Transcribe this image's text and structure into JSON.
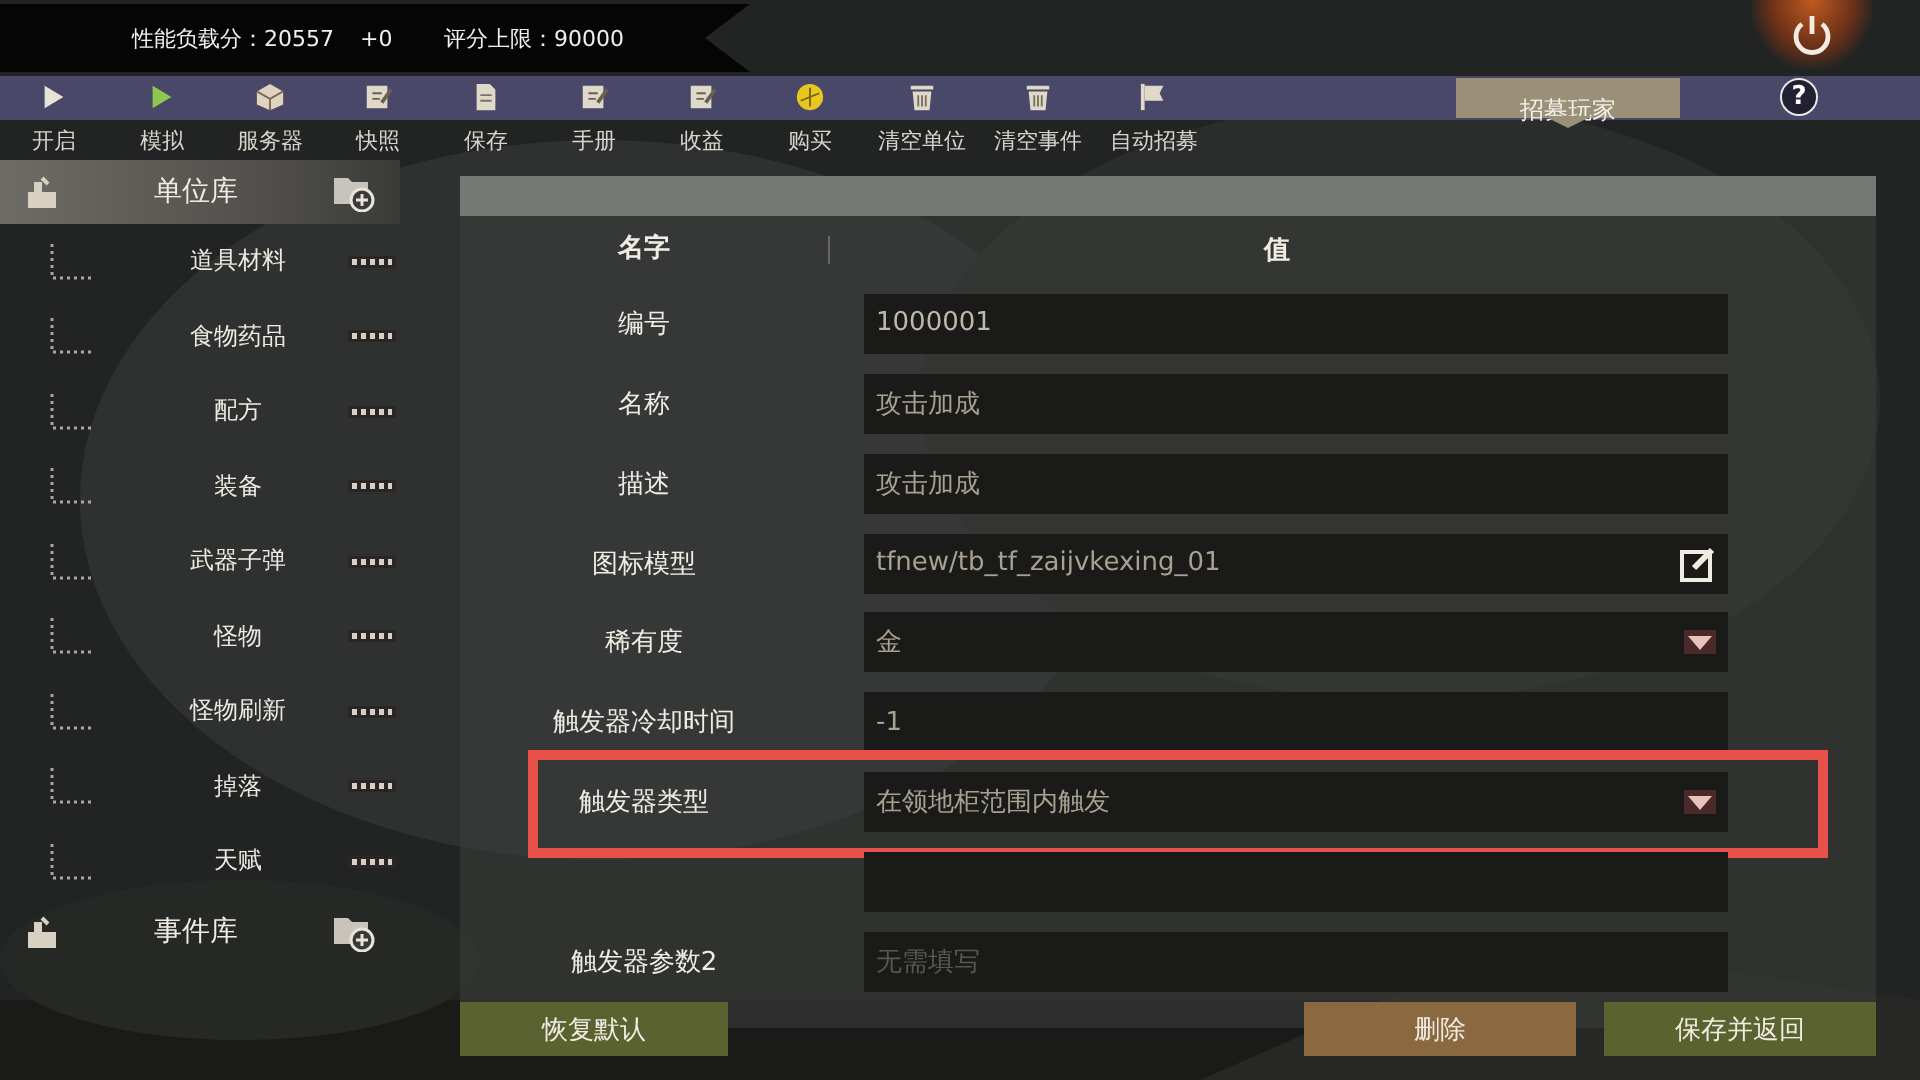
{
  "stats": [
    {
      "label": "性能负载分：20557"
    },
    {
      "label": "+0"
    },
    {
      "label": "评分上限：90000"
    }
  ],
  "toolbar": [
    {
      "label": "开启",
      "color": "#e8e4d8"
    },
    {
      "label": "模拟",
      "color": "#8cc850"
    },
    {
      "label": "服务器",
      "color": "#e0d4c0"
    },
    {
      "label": "快照",
      "color": "#e0d8c8"
    },
    {
      "label": "保存",
      "color": "#e0d8c8"
    },
    {
      "label": "手册",
      "color": "#e0d8c8"
    },
    {
      "label": "收益",
      "color": "#e0d8c8"
    },
    {
      "label": "购买",
      "color": "#e8c820"
    },
    {
      "label": "清空单位",
      "color": "#e0d8c8"
    },
    {
      "label": "清空事件",
      "color": "#e0d8c8"
    },
    {
      "label": "自动招募",
      "color": "#e0d8c8"
    }
  ],
  "recruit_button": {
    "label": "招募玩家"
  },
  "help_button": {
    "label": "?"
  },
  "sidebar": {
    "groups": [
      {
        "label": "单位库",
        "selected": true,
        "children": [
          {
            "label": "道具材料"
          },
          {
            "label": "食物药品"
          },
          {
            "label": "配方"
          },
          {
            "label": "装备"
          },
          {
            "label": "武器子弹"
          },
          {
            "label": "怪物"
          },
          {
            "label": "怪物刷新"
          },
          {
            "label": "掉落"
          },
          {
            "label": "天赋"
          }
        ]
      },
      {
        "label": "事件库",
        "selected": false
      }
    ]
  },
  "form": {
    "columns": [
      "名字",
      "值"
    ],
    "rows": [
      {
        "kind": "text",
        "label": "编号",
        "value": "1000001",
        "highlighted": false
      },
      {
        "kind": "text",
        "label": "名称",
        "value": "攻击加成",
        "highlighted": false
      },
      {
        "kind": "text",
        "label": "描述",
        "value": "攻击加成",
        "highlighted": false
      },
      {
        "kind": "edit",
        "label": "图标模型",
        "value": "tfnew/tb_tf_zaijvkexing_01",
        "highlighted": false
      },
      {
        "kind": "dropdown",
        "label": "稀有度",
        "value": "金",
        "highlighted": false
      },
      {
        "kind": "text",
        "label": "触发器冷却时间",
        "value": "-1",
        "highlighted": false
      },
      {
        "kind": "dropdown",
        "label": "触发器类型",
        "value": "在领地柜范围内触发",
        "highlighted": true
      },
      {
        "kind": "covered",
        "highlighted": false
      },
      {
        "kind": "text",
        "label": "触发器参数2",
        "placeholder": "无需填写",
        "highlighted": false
      }
    ]
  },
  "buttons": [
    {
      "label": "恢复默认",
      "kind": "reset"
    },
    {
      "label": "删除",
      "kind": "delete"
    },
    {
      "label": "保存并返回",
      "kind": "save"
    }
  ]
}
